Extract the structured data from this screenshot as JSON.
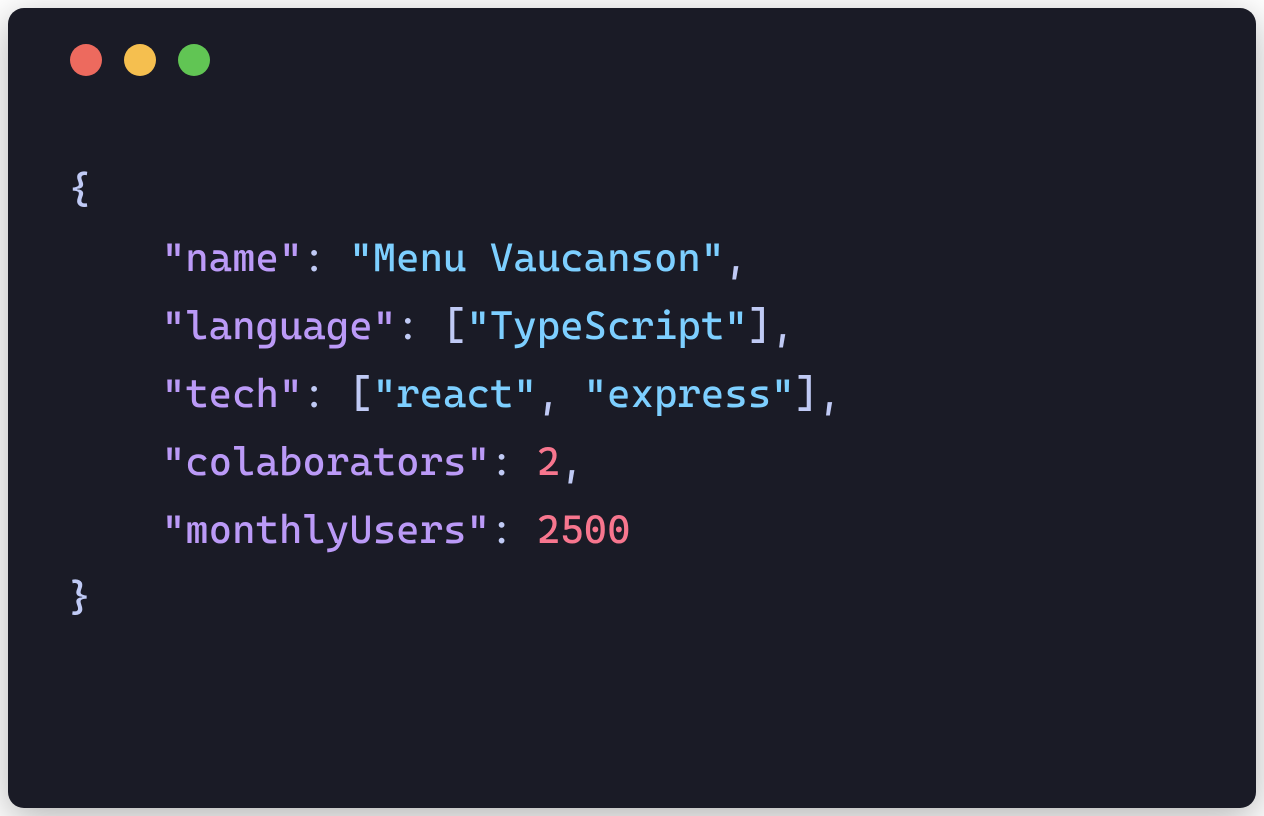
{
  "code": {
    "open_brace": "{",
    "close_brace": "}",
    "lines": [
      {
        "key": "\"name\"",
        "colon": ": ",
        "values": [
          {
            "text": "\"Menu Vaucanson\"",
            "type": "string"
          }
        ],
        "trail": ","
      },
      {
        "key": "\"language\"",
        "colon": ": ",
        "open": "[",
        "values": [
          {
            "text": "\"TypeScript\"",
            "type": "string"
          }
        ],
        "close": "]",
        "trail": ","
      },
      {
        "key": "\"tech\"",
        "colon": ": ",
        "open": "[",
        "values": [
          {
            "text": "\"react\"",
            "type": "string"
          },
          {
            "sep": ", "
          },
          {
            "text": "\"express\"",
            "type": "string"
          }
        ],
        "close": "]",
        "trail": ","
      },
      {
        "key": "\"colaborators\"",
        "colon": ": ",
        "values": [
          {
            "text": "2",
            "type": "number"
          }
        ],
        "trail": ","
      },
      {
        "key": "\"monthlyUsers\"",
        "colon": ": ",
        "values": [
          {
            "text": "2500",
            "type": "number"
          }
        ],
        "trail": ""
      }
    ]
  },
  "colors": {
    "bg": "#1a1b26",
    "red": "#ed6a5e",
    "yellow": "#f5bf4f",
    "green": "#61c554",
    "key": "#bb9af7",
    "string": "#7dcfff",
    "number": "#f7768e",
    "punct": "#c0caf5"
  }
}
